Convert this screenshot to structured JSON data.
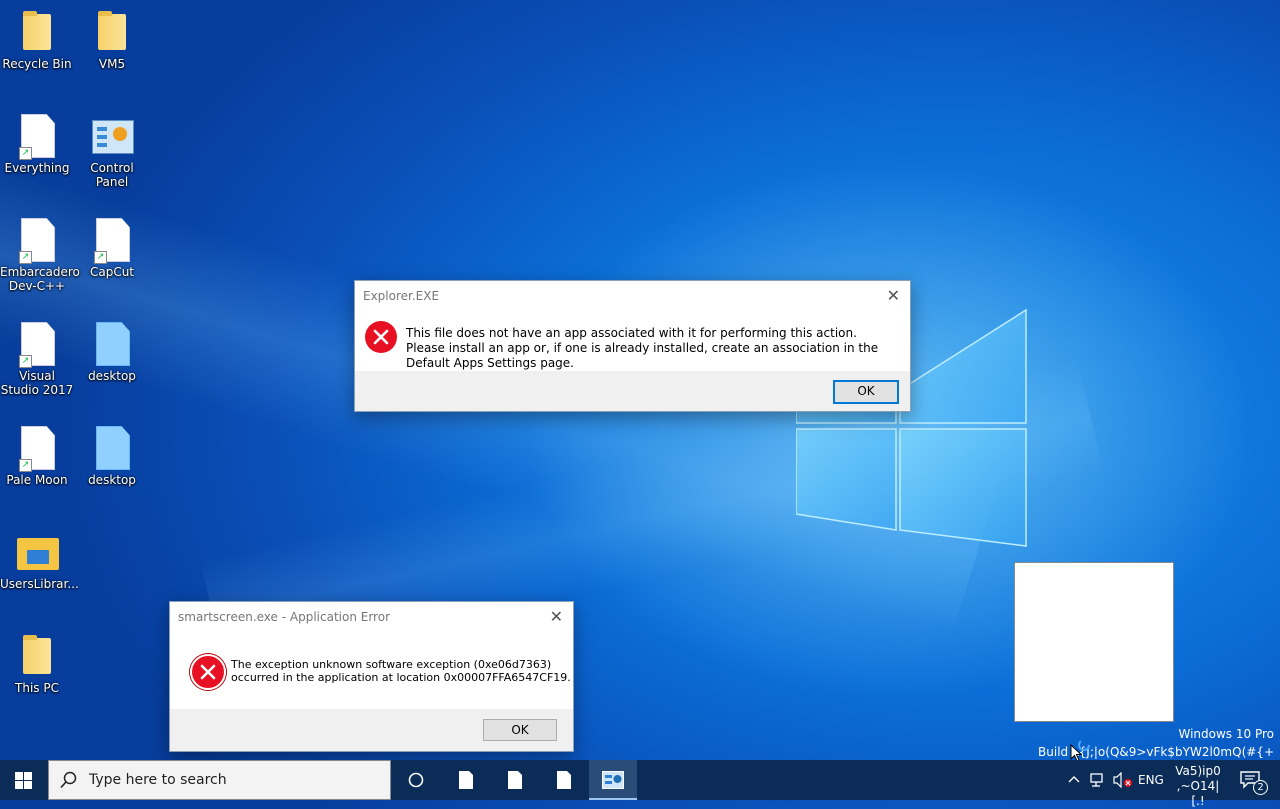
{
  "desktop": {
    "icons": [
      {
        "label": "Recycle Bin",
        "icon": "folder-icon"
      },
      {
        "label": "VM5",
        "icon": "folder-icon"
      },
      {
        "label": "Everything",
        "icon": "file-shortcut-icon"
      },
      {
        "label": "Control Panel",
        "icon": "control-panel-icon"
      },
      {
        "label": "Embarcadero Dev-C++",
        "icon": "file-shortcut-icon"
      },
      {
        "label": "CapCut",
        "icon": "file-shortcut-icon"
      },
      {
        "label": "Visual Studio 2017",
        "icon": "file-shortcut-icon"
      },
      {
        "label": "desktop",
        "icon": "file-icon"
      },
      {
        "label": "Pale Moon",
        "icon": "file-shortcut-icon"
      },
      {
        "label": "desktop",
        "icon": "file-icon"
      },
      {
        "label": "UsersLibrar...",
        "icon": "library-folder-icon"
      },
      {
        "label": "This PC",
        "icon": "folder-icon"
      }
    ]
  },
  "dialog_explorer": {
    "title": "Explorer.EXE",
    "message": "This file does not have an app associated with it for performing this action. Please install an app or, if one is already installed, create an association in the Default Apps Settings page.",
    "ok_label": "OK",
    "close_glyph": "✕"
  },
  "dialog_smartscreen": {
    "title": "smartscreen.exe - Application Error",
    "message_line1": "The exception unknown software exception (0xe06d7363)",
    "message_line2": "occurred in the application at location 0x00007FFA6547CF19.",
    "ok_label": "OK",
    "close_glyph": "✕"
  },
  "watermark": {
    "line1": "Windows 10 Pro",
    "line2": "Build L{J;|o(Q&9>vFk$bYW2l0mQ(#{+"
  },
  "taskbar": {
    "search_placeholder": "Type here to search",
    "language": "ENG",
    "clock_line1": "Va5)ip0",
    "clock_line2": ",~O14|[.!",
    "notification_count": "2"
  },
  "colors": {
    "error_red": "#e81123",
    "accent_blue": "#0078d7",
    "taskbar_bg": "#0a2c57"
  }
}
